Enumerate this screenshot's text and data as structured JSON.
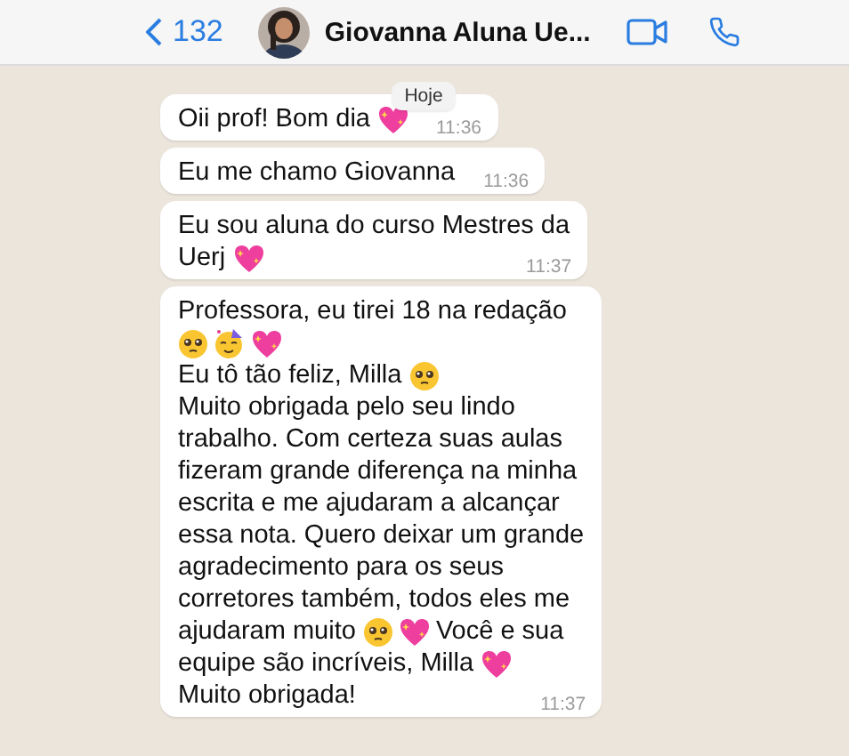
{
  "header": {
    "back_label": "132",
    "contact_name": "Giovanna Aluna Ue..."
  },
  "date_chip": "Hoje",
  "messages": [
    {
      "time": "11:36",
      "lines": [
        [
          {
            "kind": "text",
            "text": "Oii prof! Bom dia"
          },
          {
            "kind": "heart"
          }
        ]
      ]
    },
    {
      "time": "11:36",
      "lines": [
        [
          {
            "kind": "text",
            "text": "Eu me chamo Giovanna"
          }
        ]
      ]
    },
    {
      "time": "11:37",
      "lines": [
        [
          {
            "kind": "text",
            "text": "Eu sou aluna do curso Mestres da"
          }
        ],
        [
          {
            "kind": "text",
            "text": "Uerj"
          },
          {
            "kind": "heart"
          }
        ]
      ]
    },
    {
      "time": "11:37",
      "lines": [
        [
          {
            "kind": "text",
            "text": "Professora, eu tirei 18 na redação"
          }
        ],
        [
          {
            "kind": "teary"
          },
          {
            "kind": "party"
          },
          {
            "kind": "heart"
          }
        ],
        [
          {
            "kind": "text",
            "text": "Eu tô tão feliz, Milla"
          },
          {
            "kind": "teary"
          }
        ],
        [
          {
            "kind": "text",
            "text": "Muito obrigada pelo seu lindo"
          }
        ],
        [
          {
            "kind": "text",
            "text": "trabalho. Com certeza suas aulas"
          }
        ],
        [
          {
            "kind": "text",
            "text": "fizeram grande diferença na minha"
          }
        ],
        [
          {
            "kind": "text",
            "text": "escrita e me ajudaram a alcançar"
          }
        ],
        [
          {
            "kind": "text",
            "text": "essa nota. Quero deixar um grande"
          }
        ],
        [
          {
            "kind": "text",
            "text": "agradecimento para os seus"
          }
        ],
        [
          {
            "kind": "text",
            "text": "corretores também, todos eles me"
          }
        ],
        [
          {
            "kind": "text",
            "text": "ajudaram muito"
          },
          {
            "kind": "teary"
          },
          {
            "kind": "heart"
          },
          {
            "kind": "text",
            "text": "Você e sua"
          }
        ],
        [
          {
            "kind": "text",
            "text": "equipe são incríveis, Milla"
          },
          {
            "kind": "heart"
          }
        ],
        [
          {
            "kind": "text",
            "text": "Muito obrigada!"
          }
        ]
      ]
    }
  ]
}
